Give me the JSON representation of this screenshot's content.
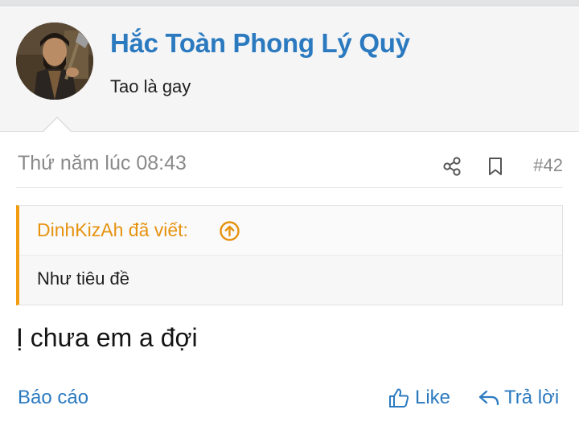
{
  "author": {
    "name": "Hắc Toàn Phong Lý Quỳ",
    "title": "Tao là gay"
  },
  "post": {
    "date": "Thứ năm lúc 08:43",
    "number": "#42",
    "body": "Ị chưa em a đợi"
  },
  "quote": {
    "author": "DinhKizAh đã viết:",
    "text": "Như tiêu đề"
  },
  "actions": {
    "report": "Báo cáo",
    "like": "Like",
    "reply": "Trả lời"
  },
  "icons": {
    "share": "share-icon",
    "bookmark": "bookmark-icon",
    "quote_jump": "arrow-up-circle-icon",
    "like": "thumbs-up-icon",
    "reply": "reply-arrow-icon"
  },
  "colors": {
    "link": "#2b7ac0",
    "quote_accent": "#f39c12",
    "meta_text": "#8a8a8a"
  }
}
